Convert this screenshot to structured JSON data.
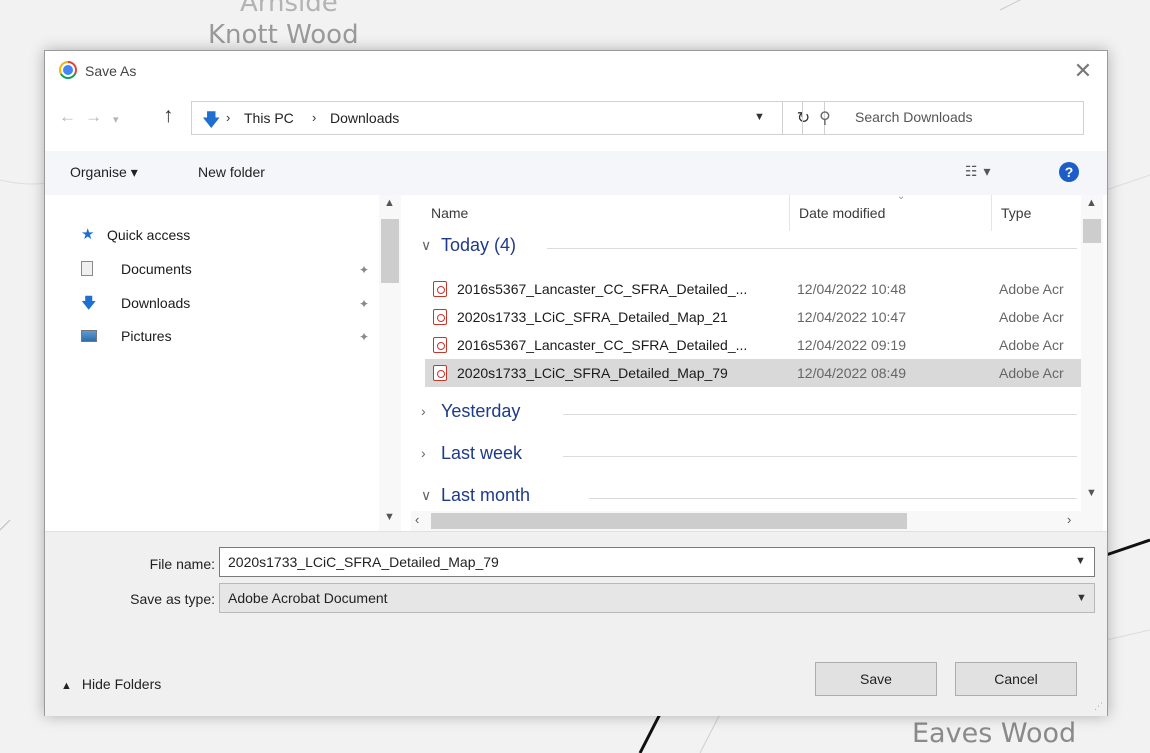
{
  "background": {
    "map_labels": [
      "Arnside",
      "Knott Wood",
      "Eaves Wood"
    ]
  },
  "dialog": {
    "title": "Save As",
    "title_icon": "chrome-icon",
    "close_glyph": "✕",
    "nav": {
      "back_glyph": "←",
      "forward_glyph": "→",
      "recent_glyph": "⌄",
      "up_glyph": "↑",
      "breadcrumb": [
        "This PC",
        "Downloads"
      ],
      "separator": "›",
      "dropdown_glyph": "⌄",
      "refresh_glyph": "↻"
    },
    "search": {
      "placeholder": "Search Downloads"
    },
    "toolbar": {
      "organise": "Organise ▾",
      "new_folder": "New folder",
      "view_glyph": "☷ ▾",
      "help": "?"
    },
    "sidebar": {
      "items": [
        {
          "label": "Quick access",
          "icon": "star-icon",
          "pinned": false
        },
        {
          "label": "Documents",
          "icon": "documents-icon",
          "pinned": true
        },
        {
          "label": "Downloads",
          "icon": "downloads-icon",
          "pinned": true
        },
        {
          "label": "Pictures",
          "icon": "pictures-icon",
          "pinned": true
        }
      ],
      "pin_glyph": "📌"
    },
    "file_list": {
      "columns": [
        "Name",
        "Date modified",
        "Type"
      ],
      "groups": [
        {
          "label": "Today (4)",
          "expanded": true
        },
        {
          "label": "Yesterday",
          "expanded": false
        },
        {
          "label": "Last week",
          "expanded": false
        },
        {
          "label": "Last month",
          "expanded": true
        }
      ],
      "files": [
        {
          "name": "2016s5367_Lancaster_CC_SFRA_Detailed_...",
          "date": "12/04/2022 10:48",
          "type": "Adobe Acr",
          "selected": false
        },
        {
          "name": "2020s1733_LCiC_SFRA_Detailed_Map_21",
          "date": "12/04/2022 10:47",
          "type": "Adobe Acr",
          "selected": false
        },
        {
          "name": "2016s5367_Lancaster_CC_SFRA_Detailed_...",
          "date": "12/04/2022 09:19",
          "type": "Adobe Acr",
          "selected": false
        },
        {
          "name": "2020s1733_LCiC_SFRA_Detailed_Map_79",
          "date": "12/04/2022 08:49",
          "type": "Adobe Acr",
          "selected": true
        }
      ]
    },
    "bottom": {
      "file_name_label": "File name:",
      "file_name_value": "2020s1733_LCiC_SFRA_Detailed_Map_79",
      "save_type_label": "Save as type:",
      "save_type_value": "Adobe Acrobat Document",
      "hide_folders": "Hide Folders",
      "save": "Save",
      "cancel": "Cancel"
    }
  },
  "colors": {
    "group_header": "#1e3a8a",
    "accent_blue": "#1e6fd0",
    "selected_row": "#d9d9d9"
  }
}
